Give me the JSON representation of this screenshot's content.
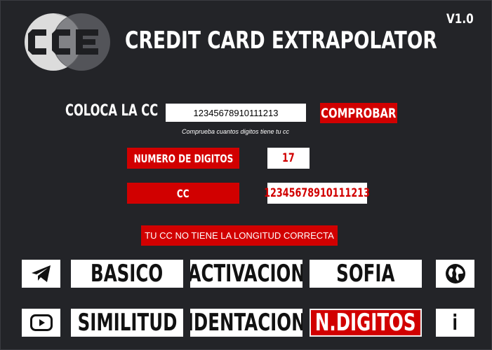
{
  "app": {
    "title": "CREDIT CARD EXTRAPOLATOR",
    "version": "V1.0",
    "logo_text": "CCE"
  },
  "input_section": {
    "label": "COLOCA LA CC",
    "value": "12345678910111213",
    "button_label": "COMPROBAR",
    "hint": "Comprueba cuantos digitos tiene tu cc"
  },
  "results": {
    "digits_label": "NUMERO DE DIGITOS",
    "digits_value": "17",
    "cc_label": "CC",
    "cc_value": "12345678910111213",
    "message": "TU CC NO TIENE LA LONGITUD CORRECTA"
  },
  "nav": {
    "row1": [
      "BASICO",
      "ACTIVACION",
      "SOFIA"
    ],
    "row2": [
      "SIMILITUD",
      "IDENTACION",
      "N.DIGITOS"
    ],
    "active": "N.DIGITOS",
    "info_label": "i",
    "icons": {
      "telegram": "telegram-icon",
      "globe": "globe-icon",
      "youtube": "youtube-icon",
      "info": "info-icon"
    }
  },
  "colors": {
    "background": "#232428",
    "accent": "#d10000",
    "text": "#ffffff"
  }
}
